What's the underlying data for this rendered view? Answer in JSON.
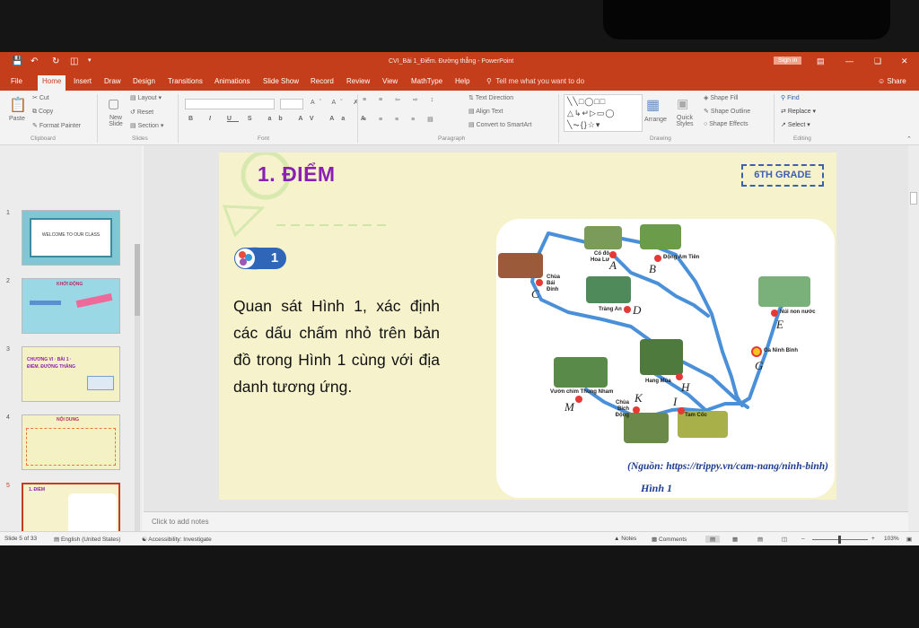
{
  "app": {
    "title": "CVI_Bài 1_Điểm. Đường thẳng - PowerPoint",
    "signin": "Sign in",
    "share": "Share",
    "tell_me": "Tell me what you want to do"
  },
  "tabs": [
    "File",
    "Home",
    "Insert",
    "Draw",
    "Design",
    "Transitions",
    "Animations",
    "Slide Show",
    "Record",
    "Review",
    "View",
    "MathType",
    "Help"
  ],
  "ribbon": {
    "paste": "Paste",
    "cut": "Cut",
    "copy": "Copy",
    "format_painter": "Format Painter",
    "new_slide": "New Slide",
    "layout": "Layout",
    "reset": "Reset",
    "section": "Section",
    "text_direction": "Text Direction",
    "align_text": "Align Text",
    "convert_smartart": "Convert to SmartArt",
    "arrange": "Arrange",
    "quick_styles": "Quick Styles",
    "shape_fill": "Shape Fill",
    "shape_outline": "Shape Outline",
    "shape_effects": "Shape Effects",
    "find": "Find",
    "replace": "Replace",
    "select": "Select",
    "groups": {
      "clipboard": "Clipboard",
      "slides": "Slides",
      "font": "Font",
      "paragraph": "Paragraph",
      "drawing": "Drawing",
      "editing": "Editing"
    }
  },
  "thumbnails": [
    {
      "num": "1",
      "text": "WELCOME TO OUR CLASS"
    },
    {
      "num": "2",
      "text": "KHỞI ĐỘNG"
    },
    {
      "num": "3",
      "text": "CHƯƠNG VI · BÀI 1 · ĐIỂM. ĐƯỜNG THẲNG"
    },
    {
      "num": "4",
      "text": "NỘI DUNG"
    },
    {
      "num": "5",
      "text": "1. ĐIỂM"
    },
    {
      "num": "6",
      "text": ""
    }
  ],
  "slide": {
    "title": "1. ĐIỂM",
    "grade": "6TH GRADE",
    "badge_number": "1",
    "body": "Quan sát Hình 1, xác định các dấu chấm nhỏ trên bản đồ trong Hình 1 cùng với địa danh tương ứng.",
    "source": "(Nguồn: https://trippy.vn/cam-nang/ninh-binh)",
    "figure_label": "Hình 1",
    "places": [
      {
        "name": "Cố đô Hoa Lư",
        "letter": "A"
      },
      {
        "name": "Động Am Tiên",
        "letter": "B"
      },
      {
        "name": "Chùa Bái Đính",
        "letter": "C"
      },
      {
        "name": "Tràng An",
        "letter": "D"
      },
      {
        "name": "Núi non nước",
        "letter": "E"
      },
      {
        "name": "Ga Ninh Bình",
        "letter": "G"
      },
      {
        "name": "Hang Múa",
        "letter": "H"
      },
      {
        "name": "Tam Cốc",
        "letter": "I"
      },
      {
        "name": "Chùa Bích Động",
        "letter": "K"
      },
      {
        "name": "Vườn chim Thung Nham",
        "letter": "M"
      }
    ]
  },
  "notes_placeholder": "Click to add notes",
  "status": {
    "slide_count": "Slide 5 of 33",
    "language": "English (United States)",
    "accessibility": "Accessibility: Investigate",
    "notes": "Notes",
    "comments": "Comments",
    "zoom": "103%"
  }
}
